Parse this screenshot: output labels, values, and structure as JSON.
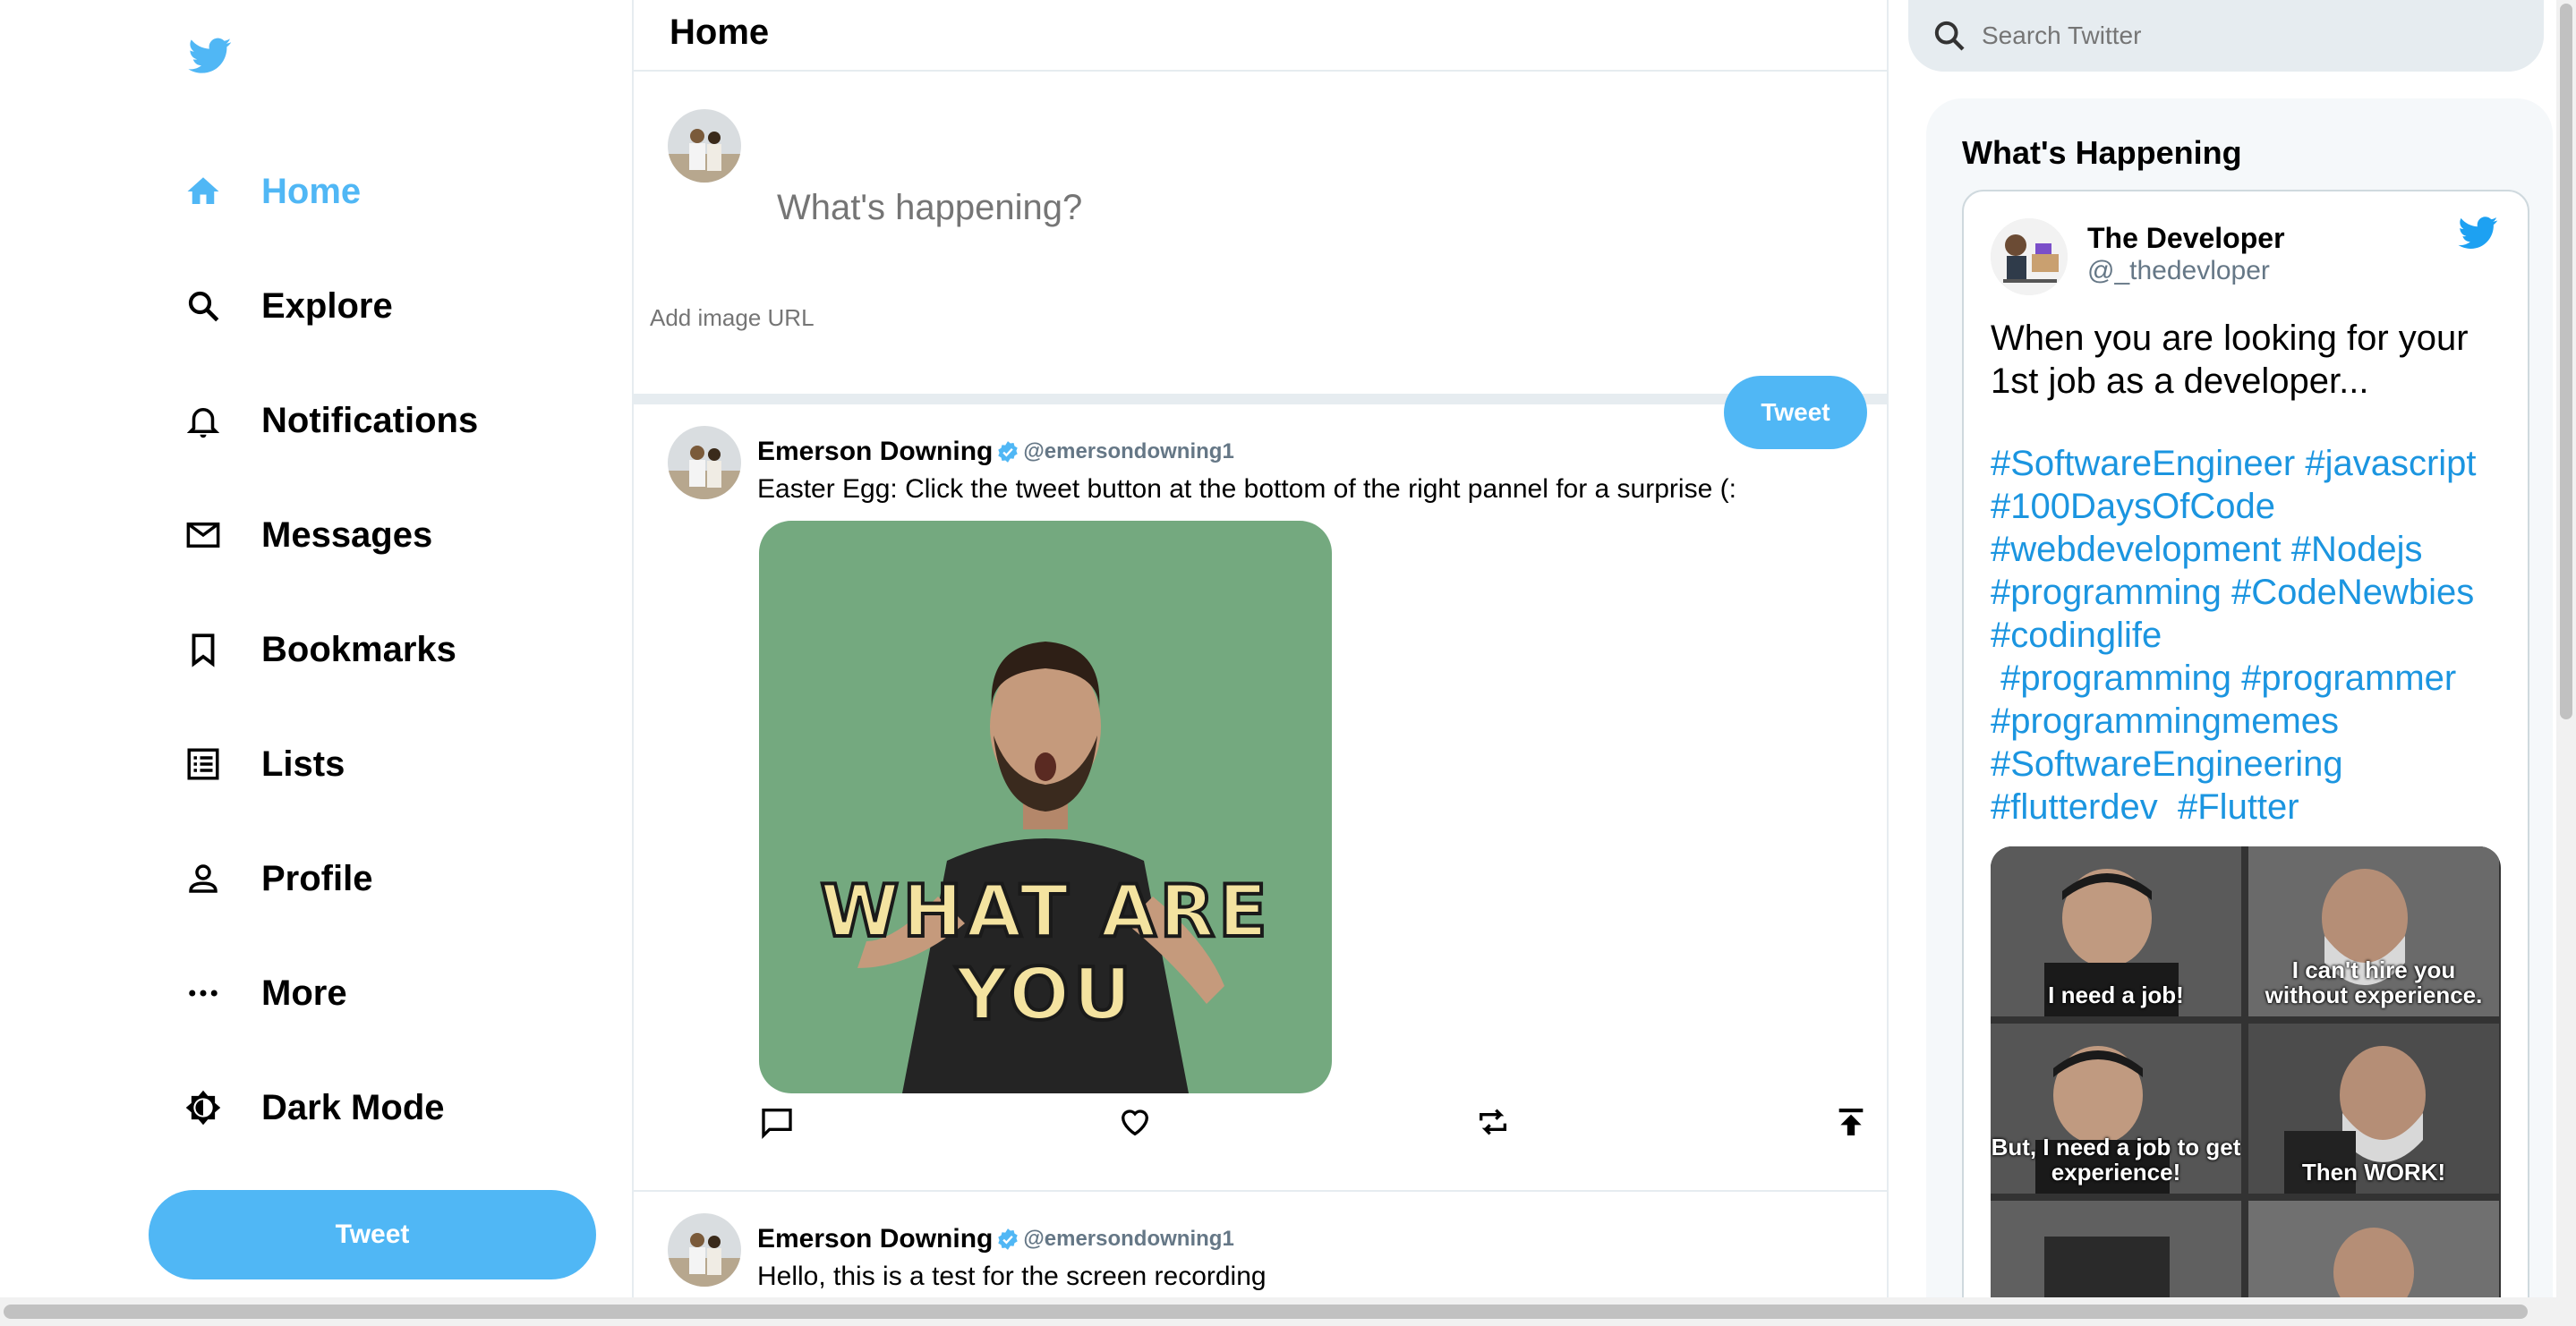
{
  "sidebar": {
    "logo_icon": "twitter-bird-icon",
    "accent_color": "#50b7f5",
    "items": [
      {
        "label": "Home",
        "icon": "home-icon",
        "active": true
      },
      {
        "label": "Explore",
        "icon": "search-icon"
      },
      {
        "label": "Notifications",
        "icon": "bell-icon"
      },
      {
        "label": "Messages",
        "icon": "mail-icon"
      },
      {
        "label": "Bookmarks",
        "icon": "bookmark-icon"
      },
      {
        "label": "Lists",
        "icon": "list-icon"
      },
      {
        "label": "Profile",
        "icon": "person-icon"
      },
      {
        "label": "More",
        "icon": "more-icon"
      },
      {
        "label": "Dark Mode",
        "icon": "brightness-icon"
      }
    ],
    "tweet_button": "Tweet"
  },
  "feed": {
    "title": "Home",
    "tweetbox": {
      "placeholder": "What's happening?",
      "image_placeholder": "Add image URL",
      "button": "Tweet"
    },
    "posts": [
      {
        "name": "Emerson Downing",
        "handle": "@emersondowning1",
        "verified": true,
        "text": "Easter Egg: Click the tweet button at the bottom of the right pannel for a surprise (:",
        "media_caption": "WHAT ARE YOU"
      },
      {
        "name": "Emerson Downing",
        "handle": "@emersondowning1",
        "verified": true,
        "text": "Hello, this is a test for the screen recording"
      }
    ]
  },
  "widgets": {
    "search_placeholder": "Search Twitter",
    "title": "What's Happening",
    "embed": {
      "name": "The Developer",
      "handle": "@_thedevloper",
      "text": "When you are looking for your 1st job as a developer...",
      "hashtags": "#SoftwareEngineer #javascript\n#100DaysOfCode\n#webdevelopment #Nodejs\n#programming #CodeNewbies\n#codinglife\n #programming #programmer\n#programmingmemes\n#SoftwareEngineering\n#flutterdev  #Flutter",
      "meme_captions": [
        "I need a job!",
        "I can't hire you without experience.",
        "But, I need a job to get experience!",
        "Then WORK!"
      ]
    }
  }
}
